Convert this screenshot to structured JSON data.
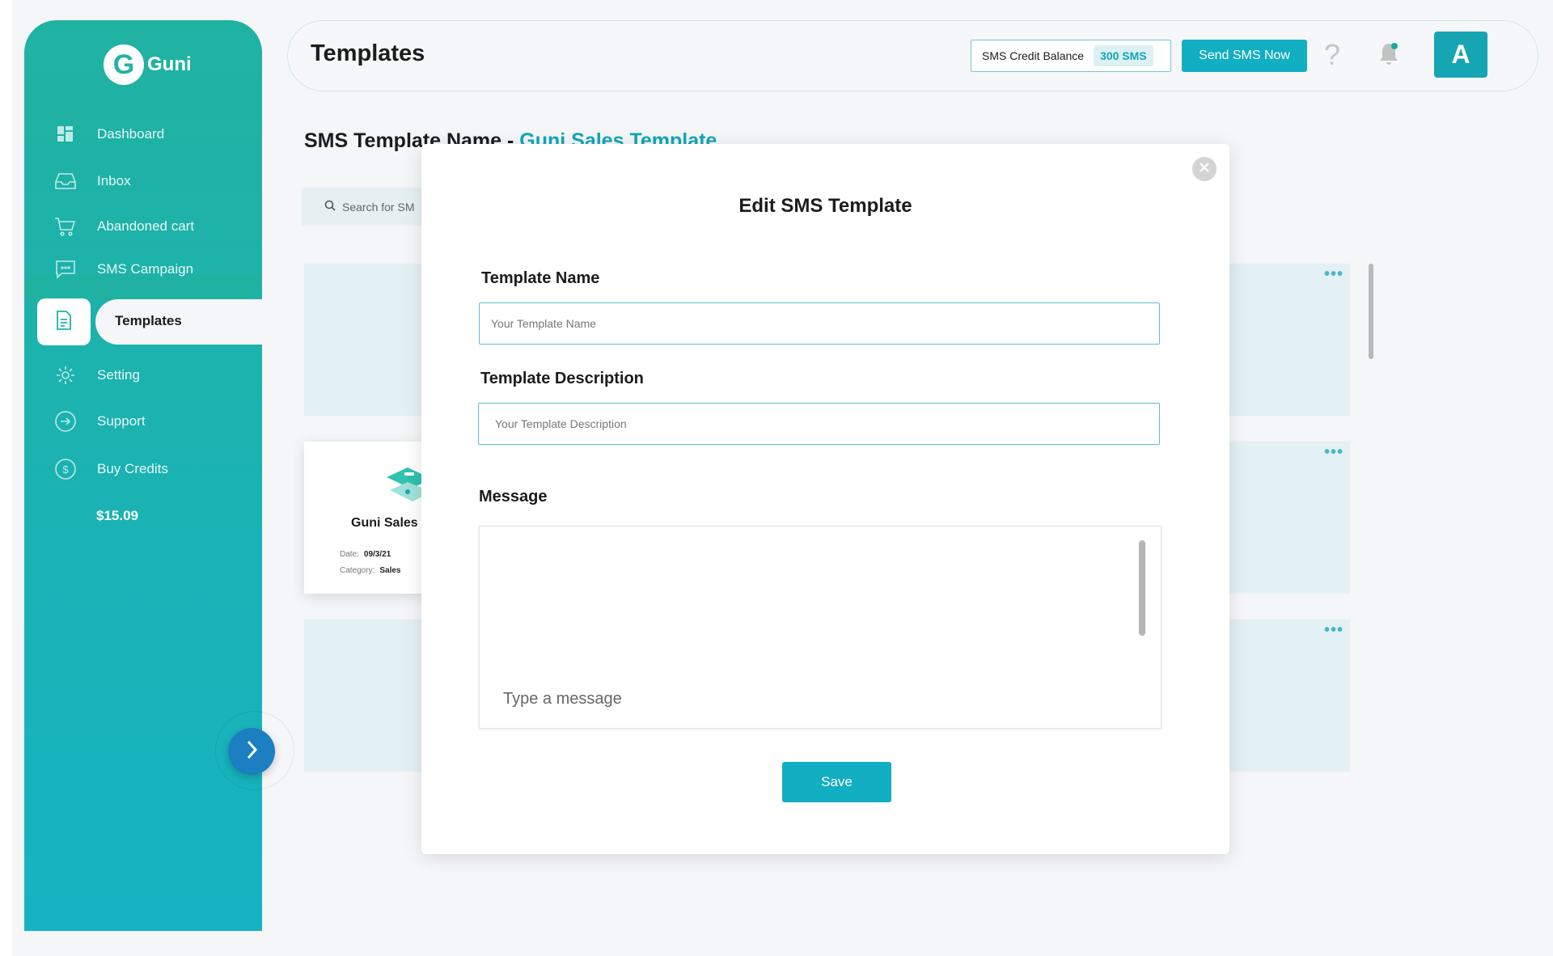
{
  "app": {
    "logo_letter": "G",
    "logo_name": "Guni"
  },
  "sidebar": {
    "items": [
      {
        "label": "Dashboard",
        "icon": "dashboard-icon"
      },
      {
        "label": "Inbox",
        "icon": "inbox-icon"
      },
      {
        "label": "Abandoned cart",
        "icon": "cart-icon"
      },
      {
        "label": "SMS Campaign",
        "icon": "message-icon"
      },
      {
        "label": "Templates",
        "icon": "document-icon",
        "active": true
      },
      {
        "label": "Setting",
        "icon": "gear-icon"
      },
      {
        "label": "Support",
        "icon": "arrow-circle-icon"
      },
      {
        "label": "Buy Credits",
        "icon": "dollar-circle-icon"
      }
    ],
    "credits_amount": "$15.09"
  },
  "header": {
    "title": "Templates",
    "credit_label": "SMS Credit Balance",
    "credit_value": "300 SMS",
    "send_button": "Send SMS Now",
    "help_glyph": "?",
    "avatar_letter": "A"
  },
  "content": {
    "subtitle_prefix": "SMS Template Name - ",
    "subtitle_name": "Guni Sales Template",
    "search_placeholder": "Search for SM",
    "card": {
      "title": "Guni Sales",
      "date_label": "Date:",
      "date_value": "09/3/21",
      "category_label": "Category:",
      "category_value": "Sales"
    },
    "more_glyph": "•••"
  },
  "modal": {
    "title": "Edit SMS Template",
    "template_name_label": "Template Name",
    "template_name_placeholder": "Your Template Name",
    "template_description_label": "Template Description",
    "template_description_placeholder": "Your Template Description",
    "message_label": "Message",
    "message_placeholder": "Type a message",
    "save_button": "Save"
  },
  "colors": {
    "sidebar_top": "#20b2a1",
    "sidebar_bottom": "#15b3c2",
    "accent": "#12aec2",
    "avatar": "#16a5b3",
    "expand_button": "#1b7fc1"
  }
}
